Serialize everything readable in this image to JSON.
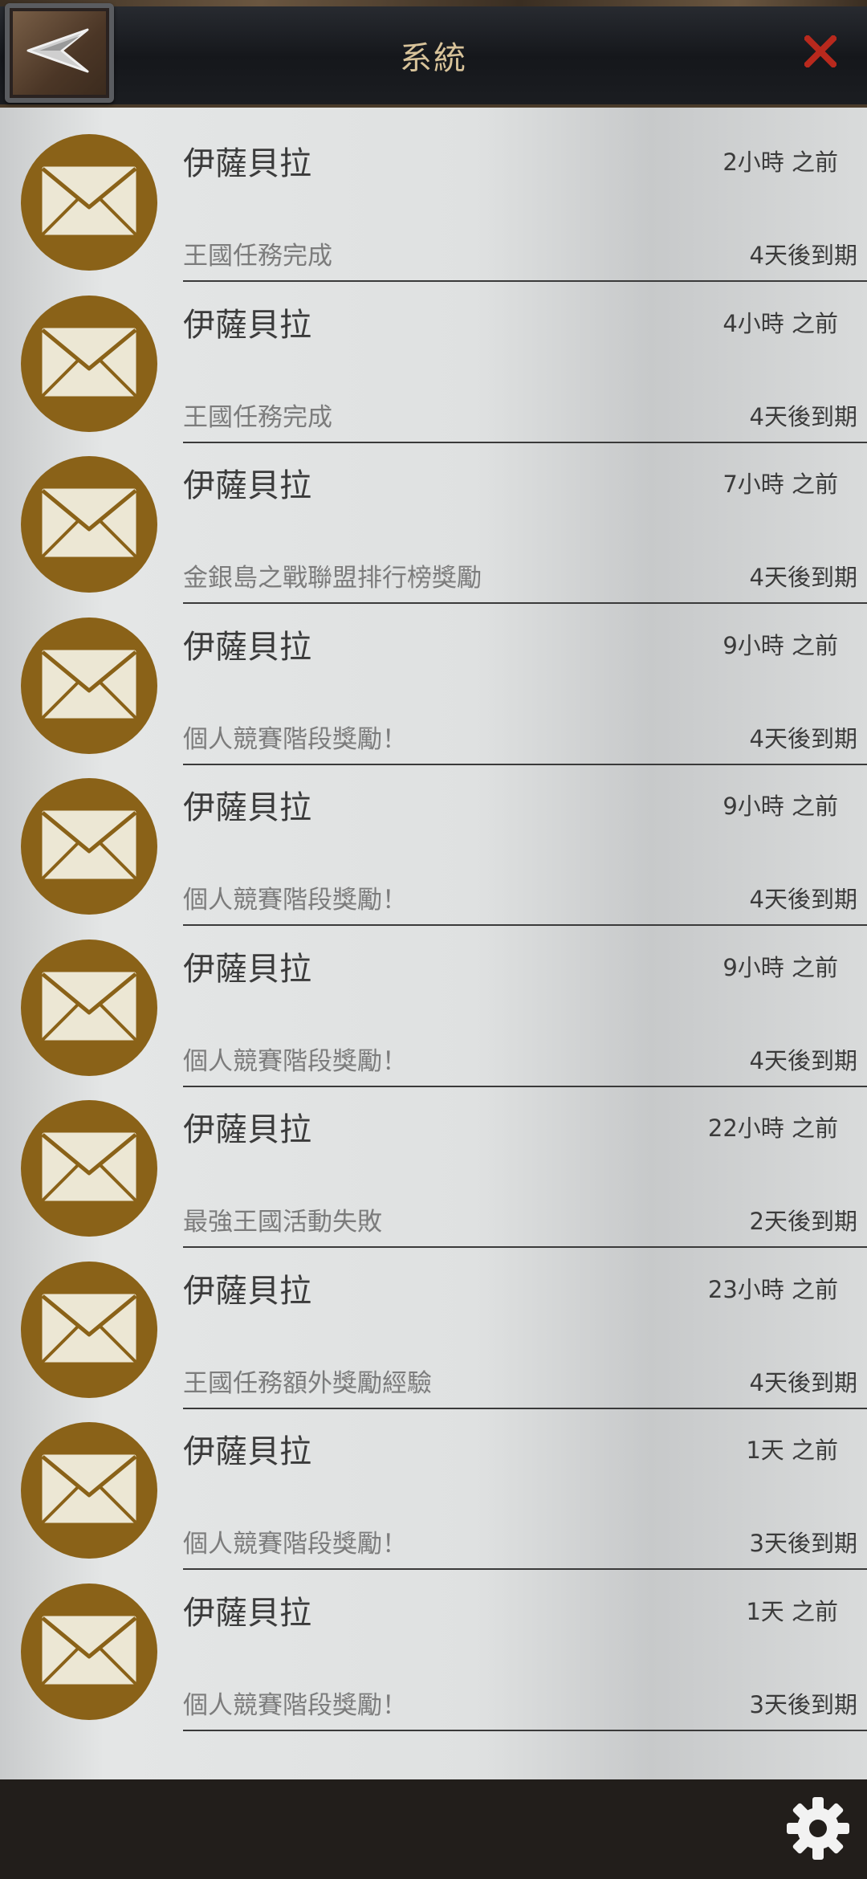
{
  "header": {
    "title": "系統"
  },
  "icons": {
    "back": "back-arrow-icon",
    "close": "close-icon",
    "mail": "envelope-icon",
    "settings": "gear-icon"
  },
  "colors": {
    "avatar_bg": "#8a6218",
    "close_x": "#b8291d",
    "title_text": "#d8c39a"
  },
  "messages": [
    {
      "sender": "伊薩貝拉",
      "time": "2小時 之前",
      "subject": "王國任務完成",
      "expiry": "4天後到期"
    },
    {
      "sender": "伊薩貝拉",
      "time": "4小時 之前",
      "subject": "王國任務完成",
      "expiry": "4天後到期"
    },
    {
      "sender": "伊薩貝拉",
      "time": "7小時 之前",
      "subject": "金銀島之戰聯盟排行榜獎勵",
      "expiry": "4天後到期"
    },
    {
      "sender": "伊薩貝拉",
      "time": "9小時 之前",
      "subject": "個人競賽階段獎勵！",
      "expiry": "4天後到期"
    },
    {
      "sender": "伊薩貝拉",
      "time": "9小時 之前",
      "subject": "個人競賽階段獎勵！",
      "expiry": "4天後到期"
    },
    {
      "sender": "伊薩貝拉",
      "time": "9小時 之前",
      "subject": "個人競賽階段獎勵！",
      "expiry": "4天後到期"
    },
    {
      "sender": "伊薩貝拉",
      "time": "22小時 之前",
      "subject": "最強王國活動失敗",
      "expiry": "2天後到期"
    },
    {
      "sender": "伊薩貝拉",
      "time": "23小時 之前",
      "subject": "王國任務額外獎勵經驗",
      "expiry": "4天後到期"
    },
    {
      "sender": "伊薩貝拉",
      "time": "1天 之前",
      "subject": "個人競賽階段獎勵！",
      "expiry": "3天後到期"
    },
    {
      "sender": "伊薩貝拉",
      "time": "1天 之前",
      "subject": "個人競賽階段獎勵！",
      "expiry": "3天後到期"
    }
  ]
}
